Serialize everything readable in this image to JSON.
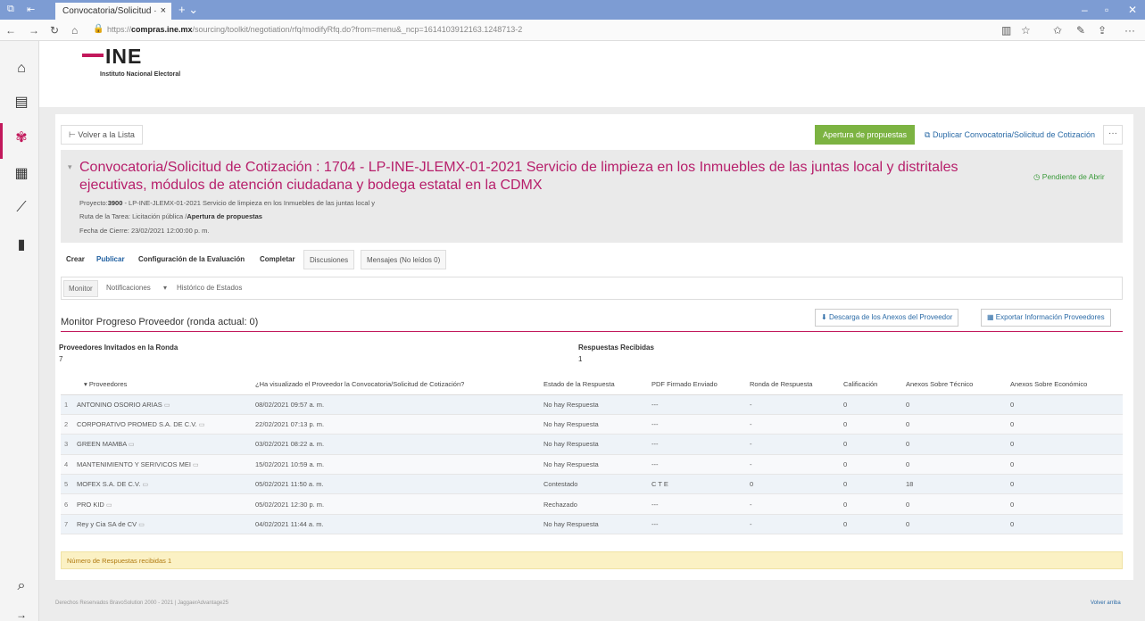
{
  "browser": {
    "tab_title": "Convocatoria/Solicitud ·",
    "url_prefix": "https://",
    "url_domain": "compras.ine.mx",
    "url_rest": "/sourcing/toolkit/negotiation/rfq/modifyRfq.do?from=menu&_ncp=1614103912163.1248713-2"
  },
  "header": {
    "logo_text": "INE",
    "logo_sub": "Instituto Nacional Electoral"
  },
  "actions": {
    "back": "Volver a la Lista",
    "open_proposals": "Apertura de propuestas",
    "duplicate": "Duplicar Convocatoria/Solicitud de Cotización",
    "more": "···"
  },
  "title": {
    "text": "Convocatoria/Solicitud de Cotización : 1704 - LP-INE-JLEMX-01-2021 Servicio de limpieza en los Inmuebles de las juntas local y distritales ejecutivas, módulos de atención ciudadana y bodega estatal en la CDMX",
    "project_label": "Proyecto:",
    "project_value": "3900",
    "project_rest": " - LP-INE-JLEMX-01-2021 Servicio de limpieza en los Inmuebles de las juntas local y",
    "route_label": "Ruta de la Tarea: Licitación pública /",
    "route_value": "Apertura de propuestas",
    "close_date": "Fecha de Cierre: 23/02/2021 12:00:00 p. m.",
    "status": "Pendiente de Abrir"
  },
  "tabs": [
    "Crear",
    "Publicar",
    "Configuración de la Evaluación",
    "Completar",
    "Discusiones",
    "Mensajes (No leídos 0)"
  ],
  "subnav": [
    "Monitor",
    "Notificaciones",
    "Histórico de Estados"
  ],
  "monitor": {
    "title": "Monitor Progreso Proveedor (ronda actual: 0)",
    "download_btn": "Descarga de los Anexos del Proveedor",
    "export_btn": "Exportar Información Proveedores",
    "invited_label": "Proveedores Invitados en la Ronda",
    "invited_value": "7",
    "responses_label": "Respuestas Recibidas",
    "responses_value": "1"
  },
  "table": {
    "headers": [
      "Proveedores",
      "¿Ha visualizado el Proveedor la Convocatoria/Solicitud de Cotización?",
      "Estado de la Respuesta",
      "PDF Firmado Enviado",
      "Ronda de Respuesta",
      "Calificación",
      "Anexos Sobre Técnico",
      "Anexos Sobre Económico"
    ],
    "rows": [
      [
        "1",
        "ANTONINO OSORIO ARIAS",
        "08/02/2021 09:57 a. m.",
        "No hay Respuesta",
        "---",
        "-",
        "0",
        "0",
        "0"
      ],
      [
        "2",
        "CORPORATIVO PROMED S.A. DE C.V.",
        "22/02/2021 07:13 p. m.",
        "No hay Respuesta",
        "---",
        "-",
        "0",
        "0",
        "0"
      ],
      [
        "3",
        "GREEN MAMBA",
        "03/02/2021 08:22 a. m.",
        "No hay Respuesta",
        "---",
        "-",
        "0",
        "0",
        "0"
      ],
      [
        "4",
        "MANTENIMIENTO Y SERIVICOS MEI",
        "15/02/2021 10:59 a. m.",
        "No hay Respuesta",
        "---",
        "-",
        "0",
        "0",
        "0"
      ],
      [
        "5",
        "MOFEX S.A. DE C.V.",
        "05/02/2021 11:50 a. m.",
        "Contestado",
        "C T E",
        "0",
        "0",
        "18",
        "0"
      ],
      [
        "6",
        "PRO KID",
        "05/02/2021 12:30 p. m.",
        "Rechazado",
        "---",
        "-",
        "0",
        "0",
        "0"
      ],
      [
        "7",
        "Rey y Cia SA de CV",
        "04/02/2021 11:44 a. m.",
        "No hay Respuesta",
        "---",
        "-",
        "0",
        "0",
        "0"
      ]
    ]
  },
  "footer": {
    "responses_count": "Número de Respuestas recibidas 1",
    "copyright": "Derechos Reservados BravoSolution 2000 - 2021 | JaggaerAdvantage25",
    "back_to_top": "Volver arriba"
  }
}
